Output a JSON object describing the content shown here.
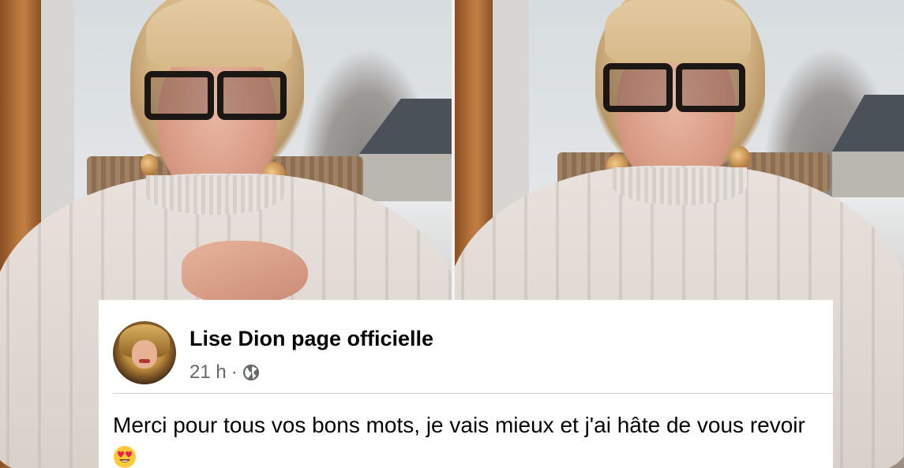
{
  "post": {
    "author": "Lise Dion page officielle",
    "time": "21 h",
    "separator": "·",
    "audience_icon": "globe-icon",
    "message": "Merci pour tous vos bons mots, je vais mieux et j'ai hâte de vous revoir",
    "emoji_icon": "heart-eyes-emoji-icon"
  }
}
